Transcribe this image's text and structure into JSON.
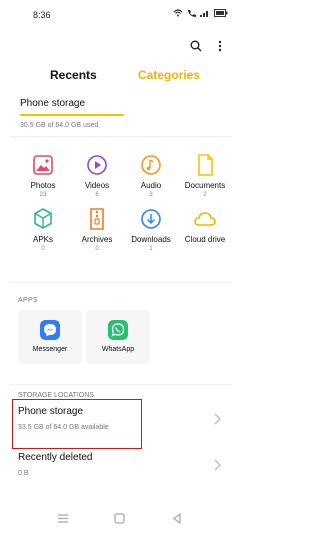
{
  "statusbar": {
    "time": "8:36"
  },
  "tabs": {
    "recents": "Recents",
    "categories": "Categories"
  },
  "storage": {
    "title": "Phone storage",
    "used": "30.5 GB of 64.0 GB used"
  },
  "categories": [
    {
      "label": "Photos",
      "count": "23",
      "icon": "photos-icon",
      "color": "#e8476a"
    },
    {
      "label": "Videos",
      "count": "6",
      "icon": "videos-icon",
      "color": "#8a4bdb"
    },
    {
      "label": "Audio",
      "count": "3",
      "icon": "audio-icon",
      "color": "#f39a1d"
    },
    {
      "label": "Documents",
      "count": "2",
      "icon": "documents-icon",
      "color": "#f5c400"
    },
    {
      "label": "APKs",
      "count": "0",
      "icon": "apk-icon",
      "color": "#36b48a"
    },
    {
      "label": "Archives",
      "count": "0",
      "icon": "archives-icon",
      "color": "#f07a2a"
    },
    {
      "label": "Downloads",
      "count": "1",
      "icon": "downloads-icon",
      "color": "#2f86e8"
    },
    {
      "label": "Cloud drive",
      "count": "",
      "icon": "cloud-icon",
      "color": "#f5b400"
    }
  ],
  "apps": {
    "heading": "APPS",
    "items": [
      {
        "label": "Messenger",
        "icon": "messenger-icon",
        "color": "#2f7df6"
      },
      {
        "label": "WhatsApp",
        "icon": "whatsapp-icon",
        "color": "#25c16f"
      }
    ]
  },
  "locations": {
    "heading": "STORAGE LOCATIONS",
    "items": [
      {
        "title": "Phone storage",
        "subtitle": "33.5 GB of 64.0 GB available"
      },
      {
        "title": "Recently deleted",
        "subtitle": "0 B"
      }
    ]
  }
}
